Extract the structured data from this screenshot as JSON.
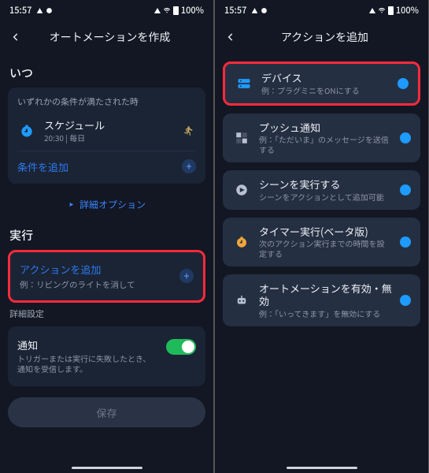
{
  "status": {
    "time": "15:57",
    "battery": "100%"
  },
  "left": {
    "title": "オートメーションを作成",
    "when_h": "いつ",
    "cond_note": "いずれかの条件が満たされた時",
    "schedule_title": "スケジュール",
    "schedule_sub": "20:30 | 毎日",
    "add_cond": "条件を追加",
    "more_opts": "詳細オプション",
    "exec_h": "実行",
    "add_action_title": "アクションを追加",
    "add_action_sub": "例：リビングのライトを消して",
    "detail_h": "詳細設定",
    "notify_title": "通知",
    "notify_sub": "トリガーまたは実行に失敗したとき、通知を受信します。",
    "save": "保存"
  },
  "right": {
    "title": "アクションを追加",
    "opts": [
      {
        "title": "デバイス",
        "sub": "例：プラグミニをONにする"
      },
      {
        "title": "プッシュ通知",
        "sub": "例：「ただいま」のメッセージを送信する"
      },
      {
        "title": "シーンを実行する",
        "sub": "シーンをアクションとして追加可能"
      },
      {
        "title": "タイマー実行(ベータ版)",
        "sub": "次のアクション実行までの時間を設定する"
      },
      {
        "title": "オートメーションを有効・無効",
        "sub": "例：「いってきます」を無効にする"
      }
    ]
  }
}
